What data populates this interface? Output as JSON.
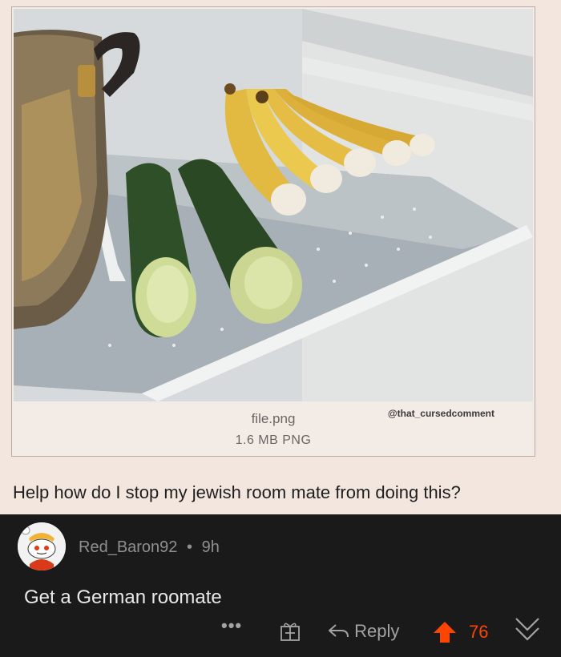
{
  "post": {
    "watermark": "@that_cursedcomment",
    "file_name": "file.png",
    "file_size": "1.6 MB PNG",
    "title": "Help how do I stop my jewish room mate from doing this?"
  },
  "comment": {
    "username": "Red_Baron92",
    "separator": "•",
    "age": "9h",
    "body": "Get a German roomate",
    "more_label": "•••",
    "reply_label": "Reply",
    "score": "76"
  },
  "colors": {
    "score": "#ff4500",
    "background": "#1a1a1b",
    "post_background": "#f2e6df"
  },
  "icons": [
    "more-icon",
    "award-icon",
    "reply-icon",
    "upvote-icon",
    "downvote-icon"
  ]
}
